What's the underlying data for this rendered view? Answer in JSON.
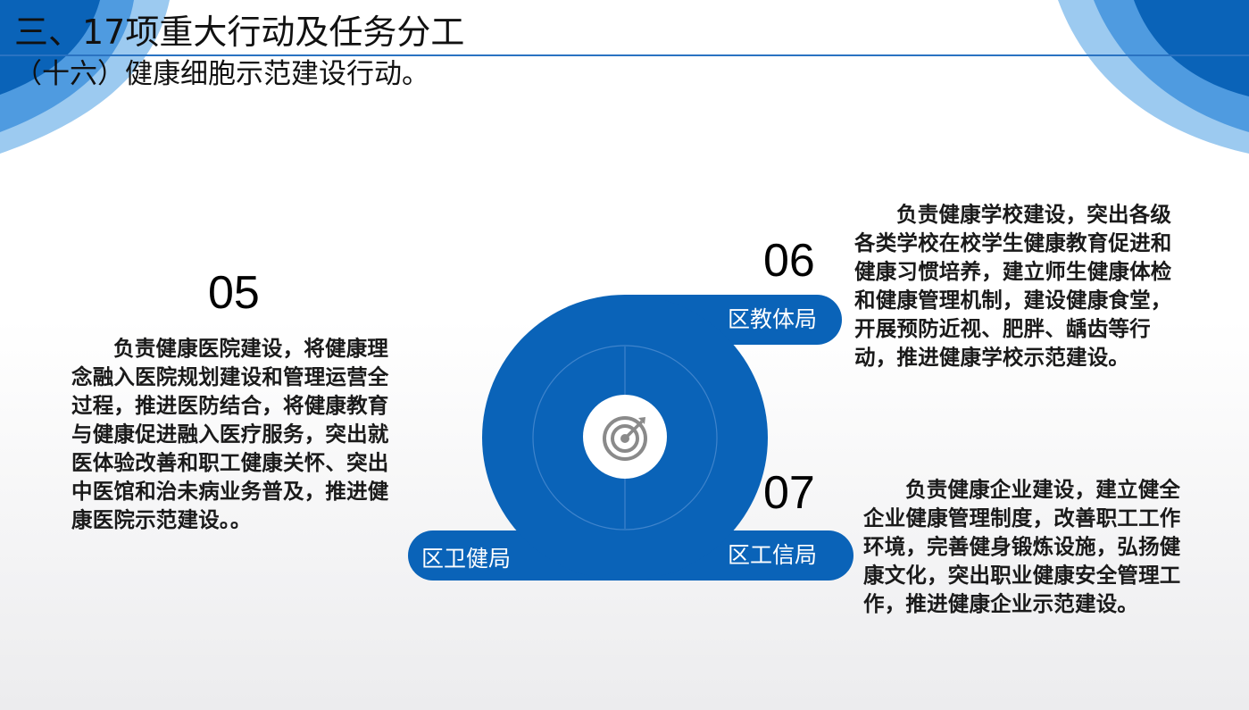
{
  "slide": {
    "title": "三、17项重大行动及任务分工",
    "subtitle": "（十六）健康细胞示范建设行动。"
  },
  "items": [
    {
      "number": "05",
      "department": "区卫健局",
      "text": "负责健康医院建设，将健康理念融入医院规划建设和管理运营全过程，推进医防结合，将健康教育与健康促进融入医疗服务，突出就医体验改善和职工健康关怀、突出中医馆和治未病业务普及，推进健康医院示范建设。。"
    },
    {
      "number": "06",
      "department": "区教体局",
      "text": "负责健康学校建设，突出各级各类学校在校学生健康教育促进和健康习惯培养，建立师生健康体检和健康管理机制，建设健康食堂，开展预防近视、肥胖、龋齿等行动，推进健康学校示范建设。"
    },
    {
      "number": "07",
      "department": "区工信局",
      "text": "负责健康企业建设，建立健全企业健康管理制度，改善职工工作环境，完善健身锻炼设施，弘扬健康文化，突出职业健康安全管理工作，推进健康企业示范建设。"
    }
  ],
  "icons": {
    "center": "target-icon"
  },
  "colors": {
    "primary_blue": "#0a63b8",
    "accent_light_blue": "#9ccaf0",
    "text_dark": "#1a1a1a"
  }
}
